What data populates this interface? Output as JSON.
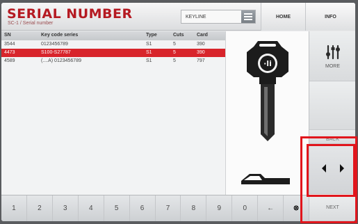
{
  "header": {
    "title": "SERIAL NUMBER",
    "subtitle": "SC-1 / Serial number",
    "keyline_value": "KEYLINE",
    "home_label": "HOME",
    "info_label": "INFO"
  },
  "table": {
    "columns": [
      "SN",
      "Key code series",
      "Type",
      "Cuts",
      "Card"
    ],
    "rows": [
      {
        "sn": "3544",
        "series": "0123456789",
        "type": "S1",
        "cuts": "5",
        "card": "390",
        "selected": false
      },
      {
        "sn": "4473",
        "series": "S100-S27787",
        "type": "S1",
        "cuts": "5",
        "card": "390",
        "selected": true
      },
      {
        "sn": "4589",
        "series": "(....A) 0123456789",
        "type": "S1",
        "cuts": "5",
        "card": "797",
        "selected": false
      }
    ]
  },
  "side": {
    "more_label": "MORE",
    "back_label": "BACK",
    "next_label": "NEXT"
  },
  "keypad": {
    "keys": [
      "1",
      "2",
      "3",
      "4",
      "5",
      "6",
      "7",
      "8",
      "9",
      "0",
      "←",
      "⊗"
    ]
  },
  "colors": {
    "accent_red": "#d8242b",
    "title_red": "#b51a22",
    "highlight_frame": "#e1151c"
  },
  "icons": [
    "tools-icon",
    "key-icon",
    "key-profile-icon",
    "arrow-left-icon",
    "arrow-right-icon",
    "backspace-icon",
    "clear-icon",
    "menu-icon"
  ]
}
